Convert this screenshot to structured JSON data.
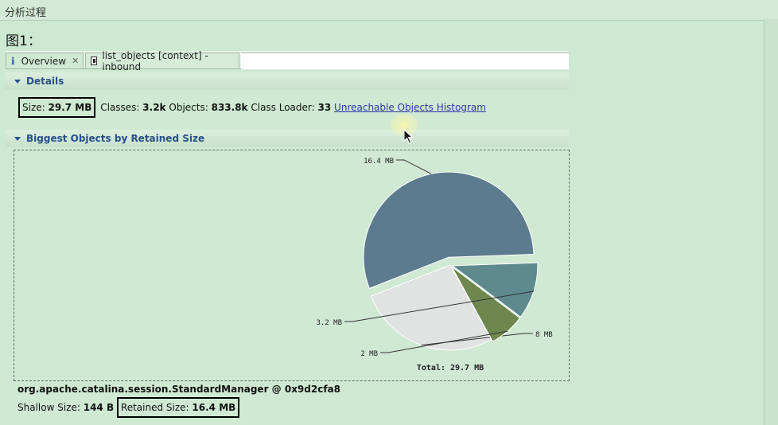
{
  "page": {
    "title": "分析过程",
    "figure_caption": "图1："
  },
  "tabs": [
    {
      "label": "Overview",
      "icon": "info-icon",
      "closable": true
    },
    {
      "label": "list_objects [context] -inbound",
      "icon": "document-icon",
      "closable": false
    }
  ],
  "details": {
    "header": "Details",
    "size_label": "Size:",
    "size_value": "29.7 MB",
    "classes_label": "Classes:",
    "classes_value": "3.2k",
    "objects_label": "Objects:",
    "objects_value": "833.8k",
    "loader_label": "Class Loader:",
    "loader_value": "33",
    "link_label": "Unreachable Objects Histogram"
  },
  "biggest": {
    "header": "Biggest Objects by Retained Size",
    "object_name": "org.apache.catalina.session.StandardManager @ 0x9d2cfa8",
    "shallow_label": "Shallow Size:",
    "shallow_value": "144 B",
    "retained_label": "Retained Size:",
    "retained_value": "16.4 MB"
  },
  "chart_data": {
    "type": "pie",
    "total_label": "Total: 29.7 MB",
    "slices": [
      {
        "label": "16.4 MB",
        "value": 16.4,
        "color": "#5d7b8e"
      },
      {
        "label": "8 MB",
        "value": 8.0,
        "color": "#e0e3e2"
      },
      {
        "label": "2 MB",
        "value": 2.0,
        "color": "#6d874e"
      },
      {
        "label": "3.2 MB",
        "value": 3.2,
        "color": "#5e8a8e"
      }
    ]
  }
}
